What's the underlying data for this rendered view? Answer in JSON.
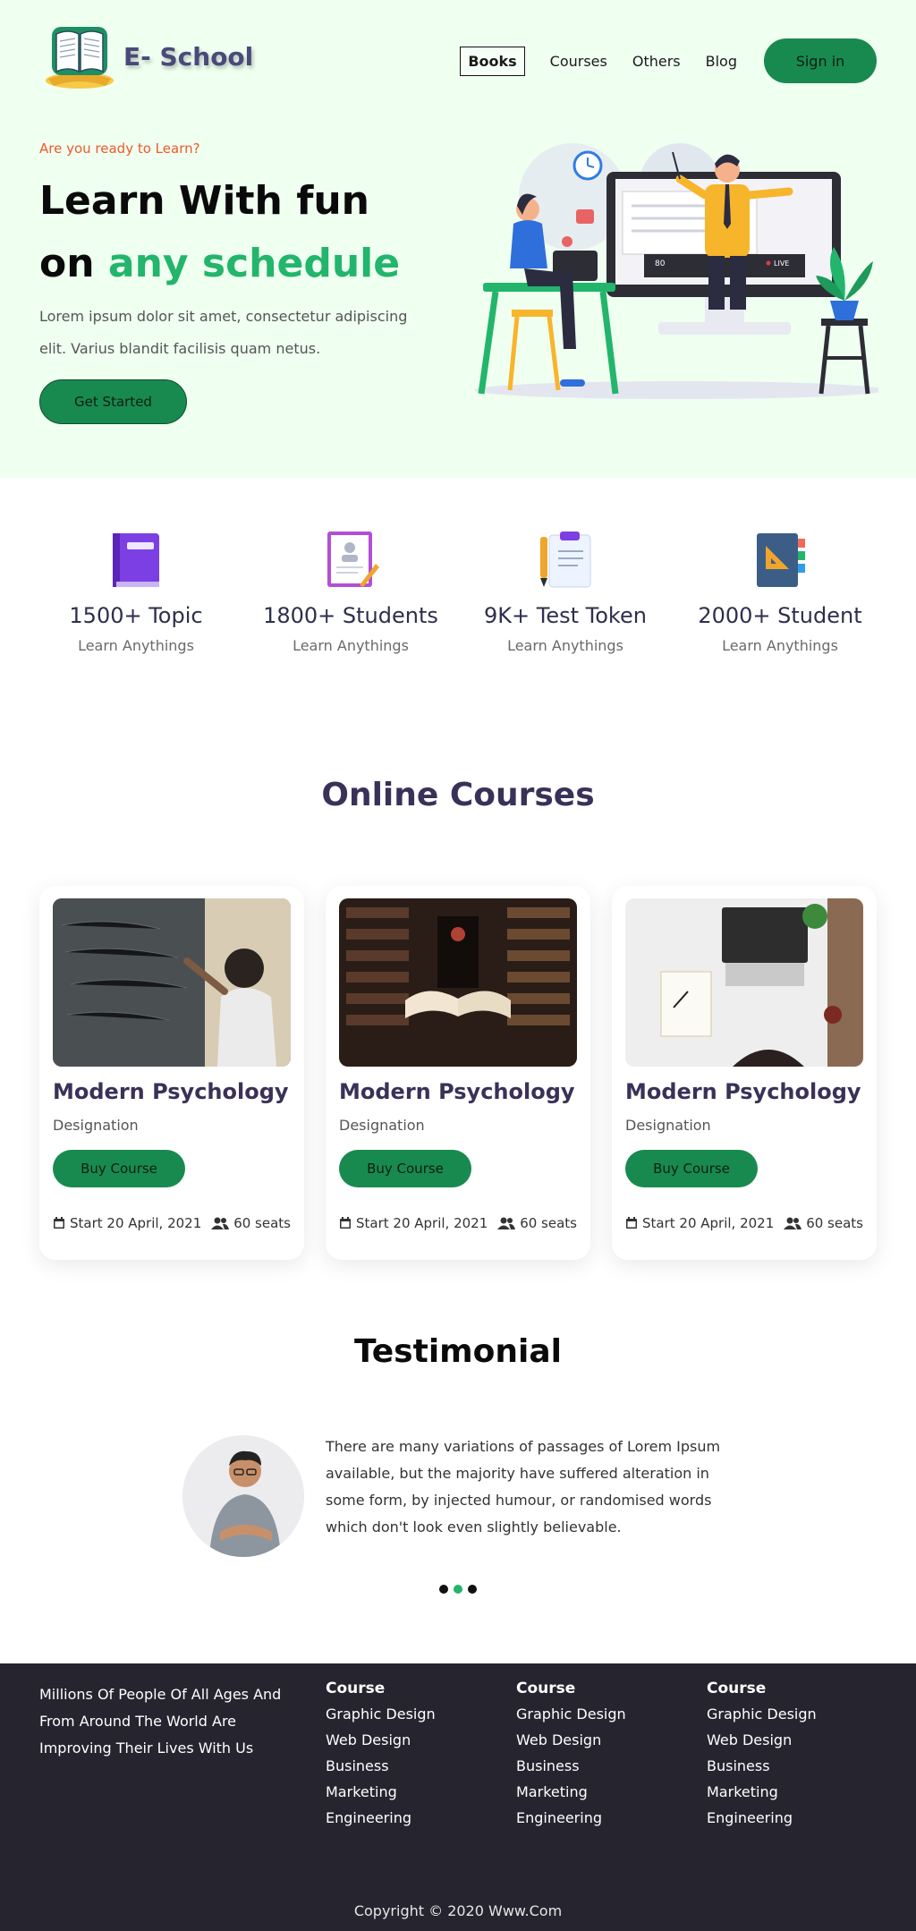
{
  "brand": {
    "name": "E- School",
    "accent": "#22b56b",
    "button_color": "#188a4f",
    "eyebrow_color": "#ef5a2b"
  },
  "nav": {
    "items": [
      {
        "label": "Books",
        "active": true
      },
      {
        "label": "Courses"
      },
      {
        "label": "Others"
      },
      {
        "label": "Blog"
      }
    ],
    "signin_label": "Sign in"
  },
  "hero": {
    "eyebrow": "Are you ready to Learn?",
    "title_line1": "Learn With fun",
    "title_line2_prefix": "on",
    "title_line2_accent": "any schedule",
    "subtitle": "Lorem ipsum dolor sit amet, consectetur adipiscing elit. Varius blandit facilisis quam netus.",
    "cta_label": "Get Started",
    "illustration": {
      "screen_count": "80",
      "live_label": "LIVE"
    }
  },
  "stats": [
    {
      "icon": "book-icon",
      "value": "1500+ Topic",
      "label": "Learn Anythings"
    },
    {
      "icon": "certificate-icon",
      "value": "1800+ Students",
      "label": "Learn Anythings"
    },
    {
      "icon": "clipboard-icon",
      "value": "9K+ Test Token",
      "label": "Learn Anythings"
    },
    {
      "icon": "notebook-icon",
      "value": "2000+ Student",
      "label": "Learn Anythings"
    }
  ],
  "courses": {
    "title": "Online Courses",
    "items": [
      {
        "image": "chalkboard-photo",
        "title": "Modern Psychology",
        "subtitle": "Designation",
        "button": "Buy Course",
        "start": "Start 20 April, 2021",
        "seats": "60 seats"
      },
      {
        "image": "library-photo",
        "title": "Modern Psychology",
        "subtitle": "Designation",
        "button": "Buy Course",
        "start": "Start 20 April, 2021",
        "seats": "60 seats"
      },
      {
        "image": "laptop-desk-photo",
        "title": "Modern Psychology",
        "subtitle": "Designation",
        "button": "Buy Course",
        "start": "Start 20 April, 2021",
        "seats": "60 seats"
      }
    ]
  },
  "testimonial": {
    "title": "Testimonial",
    "quote": "There are many variations of passages of Lorem Ipsum available, but the majority have suffered alteration in some form, by injected humour, or randomised words which don't look even slightly believable.",
    "active_dot": 1
  },
  "footer": {
    "about": "Millions Of People Of All Ages And From Around The World Are Improving Their Lives With Us",
    "columns": [
      {
        "heading": "Course",
        "links": [
          "Graphic Design",
          "Web Design",
          "Business",
          "Marketing",
          "Engineering"
        ]
      },
      {
        "heading": "Course",
        "links": [
          "Graphic Design",
          "Web Design",
          "Business",
          "Marketing",
          "Engineering"
        ]
      },
      {
        "heading": "Course",
        "links": [
          "Graphic Design",
          "Web Design",
          "Business",
          "Marketing",
          "Engineering"
        ]
      }
    ],
    "copyright": "Copyright © 2020 Www.Com"
  }
}
